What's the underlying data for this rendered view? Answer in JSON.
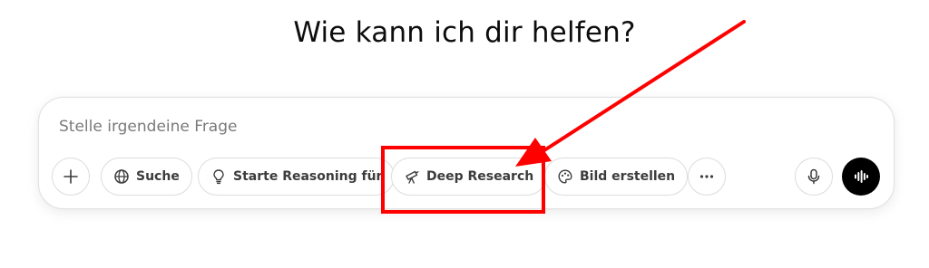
{
  "heading": "Wie kann ich dir helfen?",
  "composer": {
    "placeholder": "Stelle irgendeine Frage",
    "toolbar": {
      "search_label": "Suche",
      "reasoning_label": "Starte Reasoning für",
      "deep_research_label": "Deep Research",
      "image_label": "Bild erstellen"
    }
  },
  "icons": {
    "add": "plus-icon",
    "search": "globe-icon",
    "reasoning": "lightbulb-icon",
    "deep_research": "telescope-icon",
    "image": "palette-icon",
    "more": "ellipsis-icon",
    "dictate": "microphone-icon",
    "voice": "voice-waveform-icon"
  },
  "colors": {
    "annotation": "#ff0000",
    "voice_button": "#000000",
    "pill_border": "#dcdcdc"
  }
}
